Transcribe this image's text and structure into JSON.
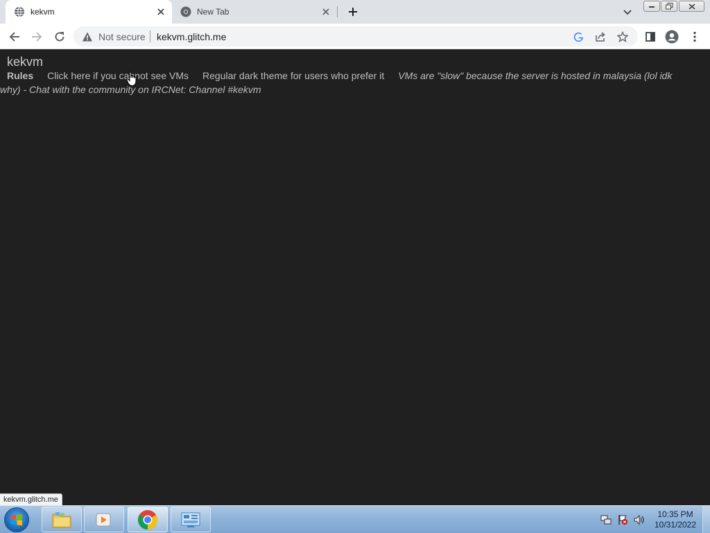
{
  "browser": {
    "tabs": [
      {
        "title": "kekvm",
        "active": true
      },
      {
        "title": "New Tab",
        "active": false
      }
    ],
    "omnibox": {
      "security_label": "Not secure",
      "url": "kekvm.glitch.me"
    }
  },
  "page": {
    "site_title": "kekvm",
    "nav": {
      "rules": "Rules",
      "cant_see_vms": "Click here if you cannot see VMs",
      "dark_theme": "Regular dark theme for users who prefer it",
      "note": "VMs are \"slow\" because the server is hosted in malaysia (lol idk why) - Chat with the community on IRCNet: Channel #kekvm"
    },
    "status_bar_url": "kekvm.glitch.me",
    "background_color": "#202020",
    "text_color": "#bdbdbd"
  },
  "taskbar": {
    "apps": [
      "windows-explorer",
      "media-player",
      "google-chrome",
      "control-panel"
    ],
    "clock": {
      "time": "10:35 PM",
      "date": "10/31/2022"
    }
  }
}
